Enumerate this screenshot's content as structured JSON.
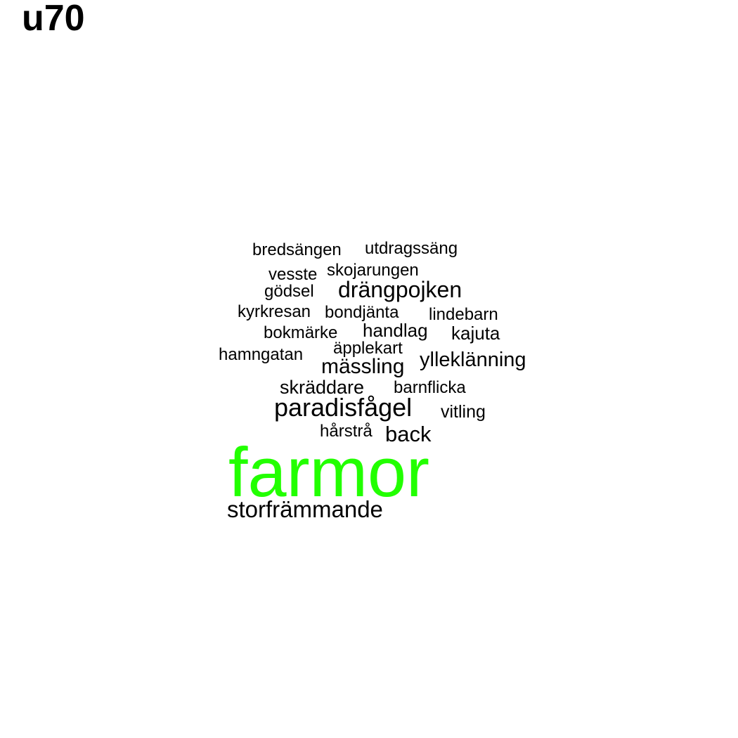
{
  "panel_label": "u70",
  "colors": {
    "highlight": "#22ff00",
    "default": "#000000"
  },
  "words": [
    {
      "text": "bredsängen"
    },
    {
      "text": "utdragssäng"
    },
    {
      "text": "vesste"
    },
    {
      "text": "skojarungen"
    },
    {
      "text": "gödsel"
    },
    {
      "text": "drängpojken"
    },
    {
      "text": "kyrkresan"
    },
    {
      "text": "bondjänta"
    },
    {
      "text": "lindebarn"
    },
    {
      "text": "bokmärke"
    },
    {
      "text": "handlag"
    },
    {
      "text": "kajuta"
    },
    {
      "text": "äpplekart"
    },
    {
      "text": "hamngatan"
    },
    {
      "text": "mässling"
    },
    {
      "text": "ylleklänning"
    },
    {
      "text": "skräddare"
    },
    {
      "text": "barnflicka"
    },
    {
      "text": "paradisfågel"
    },
    {
      "text": "vitling"
    },
    {
      "text": "hårstrå"
    },
    {
      "text": "back"
    },
    {
      "text": "farmor",
      "color": "#22ff00"
    },
    {
      "text": "storfrämmande"
    }
  ]
}
